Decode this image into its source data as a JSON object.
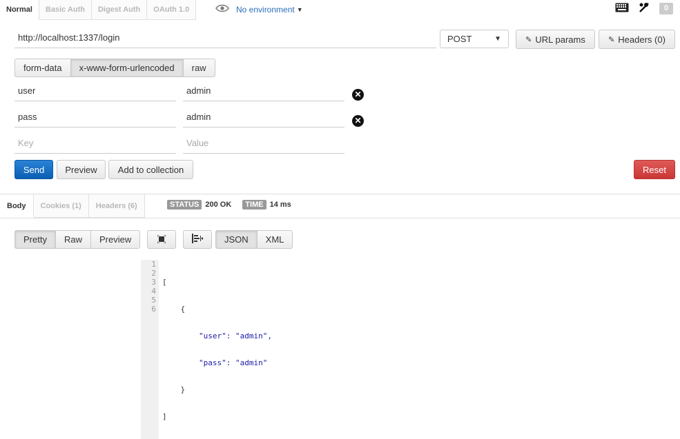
{
  "auth_tabs": [
    "Normal",
    "Basic Auth",
    "Digest Auth",
    "OAuth 1.0"
  ],
  "environment": "No environment",
  "badge_count": "0",
  "request": {
    "url": "http://localhost:1337/login",
    "method": "POST",
    "url_params_label": "URL params",
    "headers_label": "Headers (0)"
  },
  "body_types": [
    "form-data",
    "x-www-form-urlencoded",
    "raw"
  ],
  "params": [
    {
      "key": "user",
      "value": "admin"
    },
    {
      "key": "pass",
      "value": "admin"
    }
  ],
  "new_param": {
    "key_placeholder": "Key",
    "value_placeholder": "Value"
  },
  "actions": {
    "send": "Send",
    "preview": "Preview",
    "add_collection": "Add to collection",
    "reset": "Reset"
  },
  "response_tabs": [
    "Body",
    "Cookies (1)",
    "Headers (6)"
  ],
  "status": {
    "status_label": "STATUS",
    "status_value": "200 OK",
    "time_label": "TIME",
    "time_value": "14 ms"
  },
  "view_modes": [
    "Pretty",
    "Raw",
    "Preview"
  ],
  "formats": [
    "JSON",
    "XML"
  ],
  "code": {
    "line_numbers": [
      "1",
      "2",
      "3",
      "4",
      "5",
      "6"
    ],
    "lines": [
      "[",
      "    {",
      "        \"user\": \"admin\",",
      "        \"pass\": \"admin\"",
      "    }",
      "]"
    ]
  },
  "colors": {
    "accent": "#0a5fb4",
    "danger": "#c93735",
    "env_link": "#2a6ebb"
  }
}
